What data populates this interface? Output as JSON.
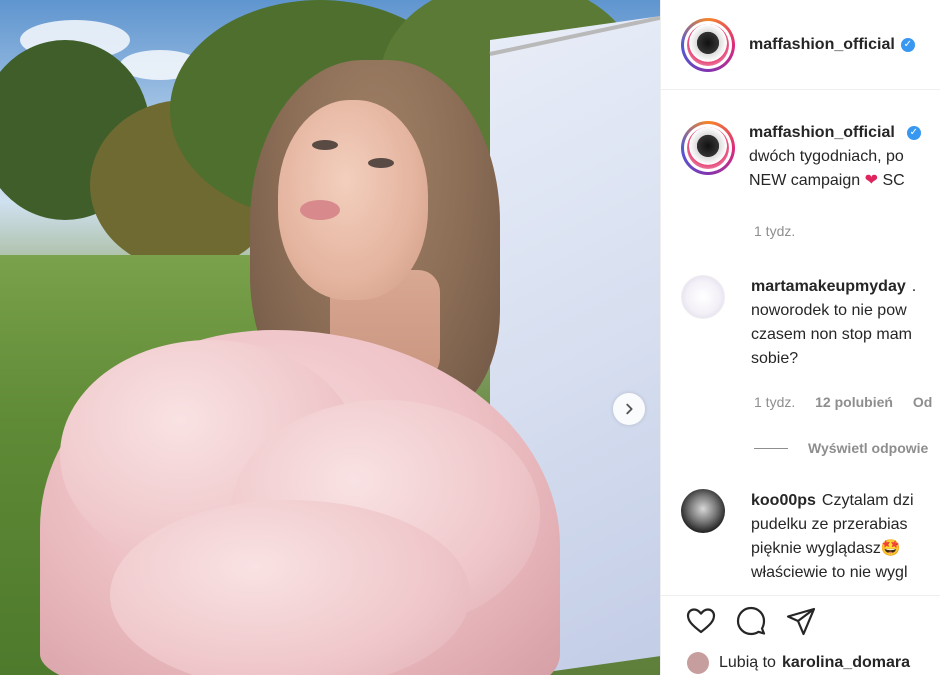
{
  "post": {
    "username": "maffashion_official",
    "next_icon": "chevron-right-icon"
  },
  "caption": {
    "username": "maffashion_official",
    "line1": "dwóch tygodniach, po",
    "line2_a": "NEW campaign",
    "line2_b": "SC",
    "time": "1 tydz."
  },
  "comments": [
    {
      "username": "martamakeupmyday",
      "text_after_name": ".",
      "lines": [
        "noworodek to nie pow",
        "czasem non stop mam",
        "sobie?"
      ],
      "time": "1 tydz.",
      "likes": "12 polubień",
      "reply": "Od",
      "view_replies": "Wyświetl odpowie"
    },
    {
      "username": "koo00ps",
      "first_line_text": "Czytalam dzi",
      "lines": [
        "pudelku ze przerabias",
        "pięknie wyglądasz🤩",
        "właściewie to nie wygl"
      ]
    }
  ],
  "footer": {
    "likes_prefix": "Lubią to",
    "likes_user": "karolina_domara"
  },
  "colors": {
    "verified": "#3897f0",
    "heart": "#e0245e",
    "muted": "#8e8e8e"
  }
}
